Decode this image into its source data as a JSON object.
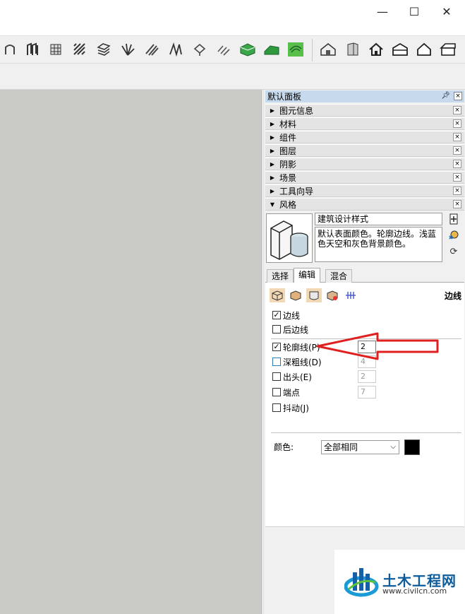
{
  "window": {
    "minimize_glyph": "—",
    "maximize_glyph": "☐",
    "close_glyph": "✕"
  },
  "tray": {
    "title": "默认面板",
    "sections": [
      "图元信息",
      "材料",
      "组件",
      "图层",
      "阴影",
      "场景",
      "工具向导"
    ],
    "open_section": "风格"
  },
  "style": {
    "name": "建筑设计样式",
    "description": "默认表面颜色。轮廓边线。浅蓝色天空和灰色背景颜色。"
  },
  "tabs": [
    "选择",
    "编辑",
    "混合"
  ],
  "active_tab": "编辑",
  "edit": {
    "category_title": "边线",
    "options": [
      {
        "label": "边线",
        "checked": true,
        "value": null
      },
      {
        "label": "后边线",
        "checked": false,
        "value": null
      },
      {
        "label": "轮廓线(P)",
        "checked": true,
        "value": "2"
      },
      {
        "label": "深粗线(D)",
        "checked": false,
        "value": "4"
      },
      {
        "label": "出头(E)",
        "checked": false,
        "value": "2"
      },
      {
        "label": "端点",
        "checked": false,
        "value": "7"
      },
      {
        "label": "抖动(J)",
        "checked": false,
        "value": null
      }
    ],
    "color_label": "颜色:",
    "color_mode": "全部相同",
    "color_swatch": "#000000"
  },
  "watermark": {
    "name": "土木工程网",
    "url": "www.civilcn.com"
  },
  "colors": {
    "canvas": "#c9cbc4",
    "tray_title": "#c7d9ec",
    "arrow": "#e02020"
  }
}
